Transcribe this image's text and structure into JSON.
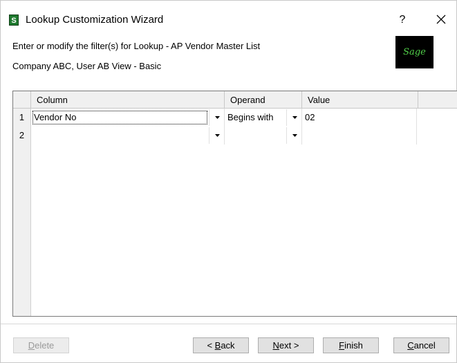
{
  "window": {
    "title": "Lookup Customization Wizard",
    "app_icon_letter": "S",
    "help_label": "?",
    "close_icon": "close-icon"
  },
  "header": {
    "line1": "Enter or modify the filter(s) for Lookup - AP Vendor Master List",
    "line2": "Company ABC, User AB View - Basic",
    "logo_text": "Sage"
  },
  "grid": {
    "columns": [
      "Column",
      "Operand",
      "Value"
    ],
    "rows": [
      {
        "num": "1",
        "column": "Vendor No",
        "operand": "Begins with",
        "value": "02"
      },
      {
        "num": "2",
        "column": "",
        "operand": "",
        "value": ""
      }
    ]
  },
  "buttons": {
    "delete": {
      "pre": "",
      "key": "D",
      "post": "elete"
    },
    "back": {
      "pre": "< ",
      "key": "B",
      "post": "ack"
    },
    "next": {
      "pre": "",
      "key": "N",
      "post": "ext >"
    },
    "finish": {
      "pre": "",
      "key": "F",
      "post": "inish"
    },
    "cancel": {
      "pre": "",
      "key": "C",
      "post": "ancel"
    }
  },
  "colors": {
    "logo_bg": "#000000",
    "logo_fg": "#52d14a",
    "app_icon_bg": "#1f7a2f"
  }
}
